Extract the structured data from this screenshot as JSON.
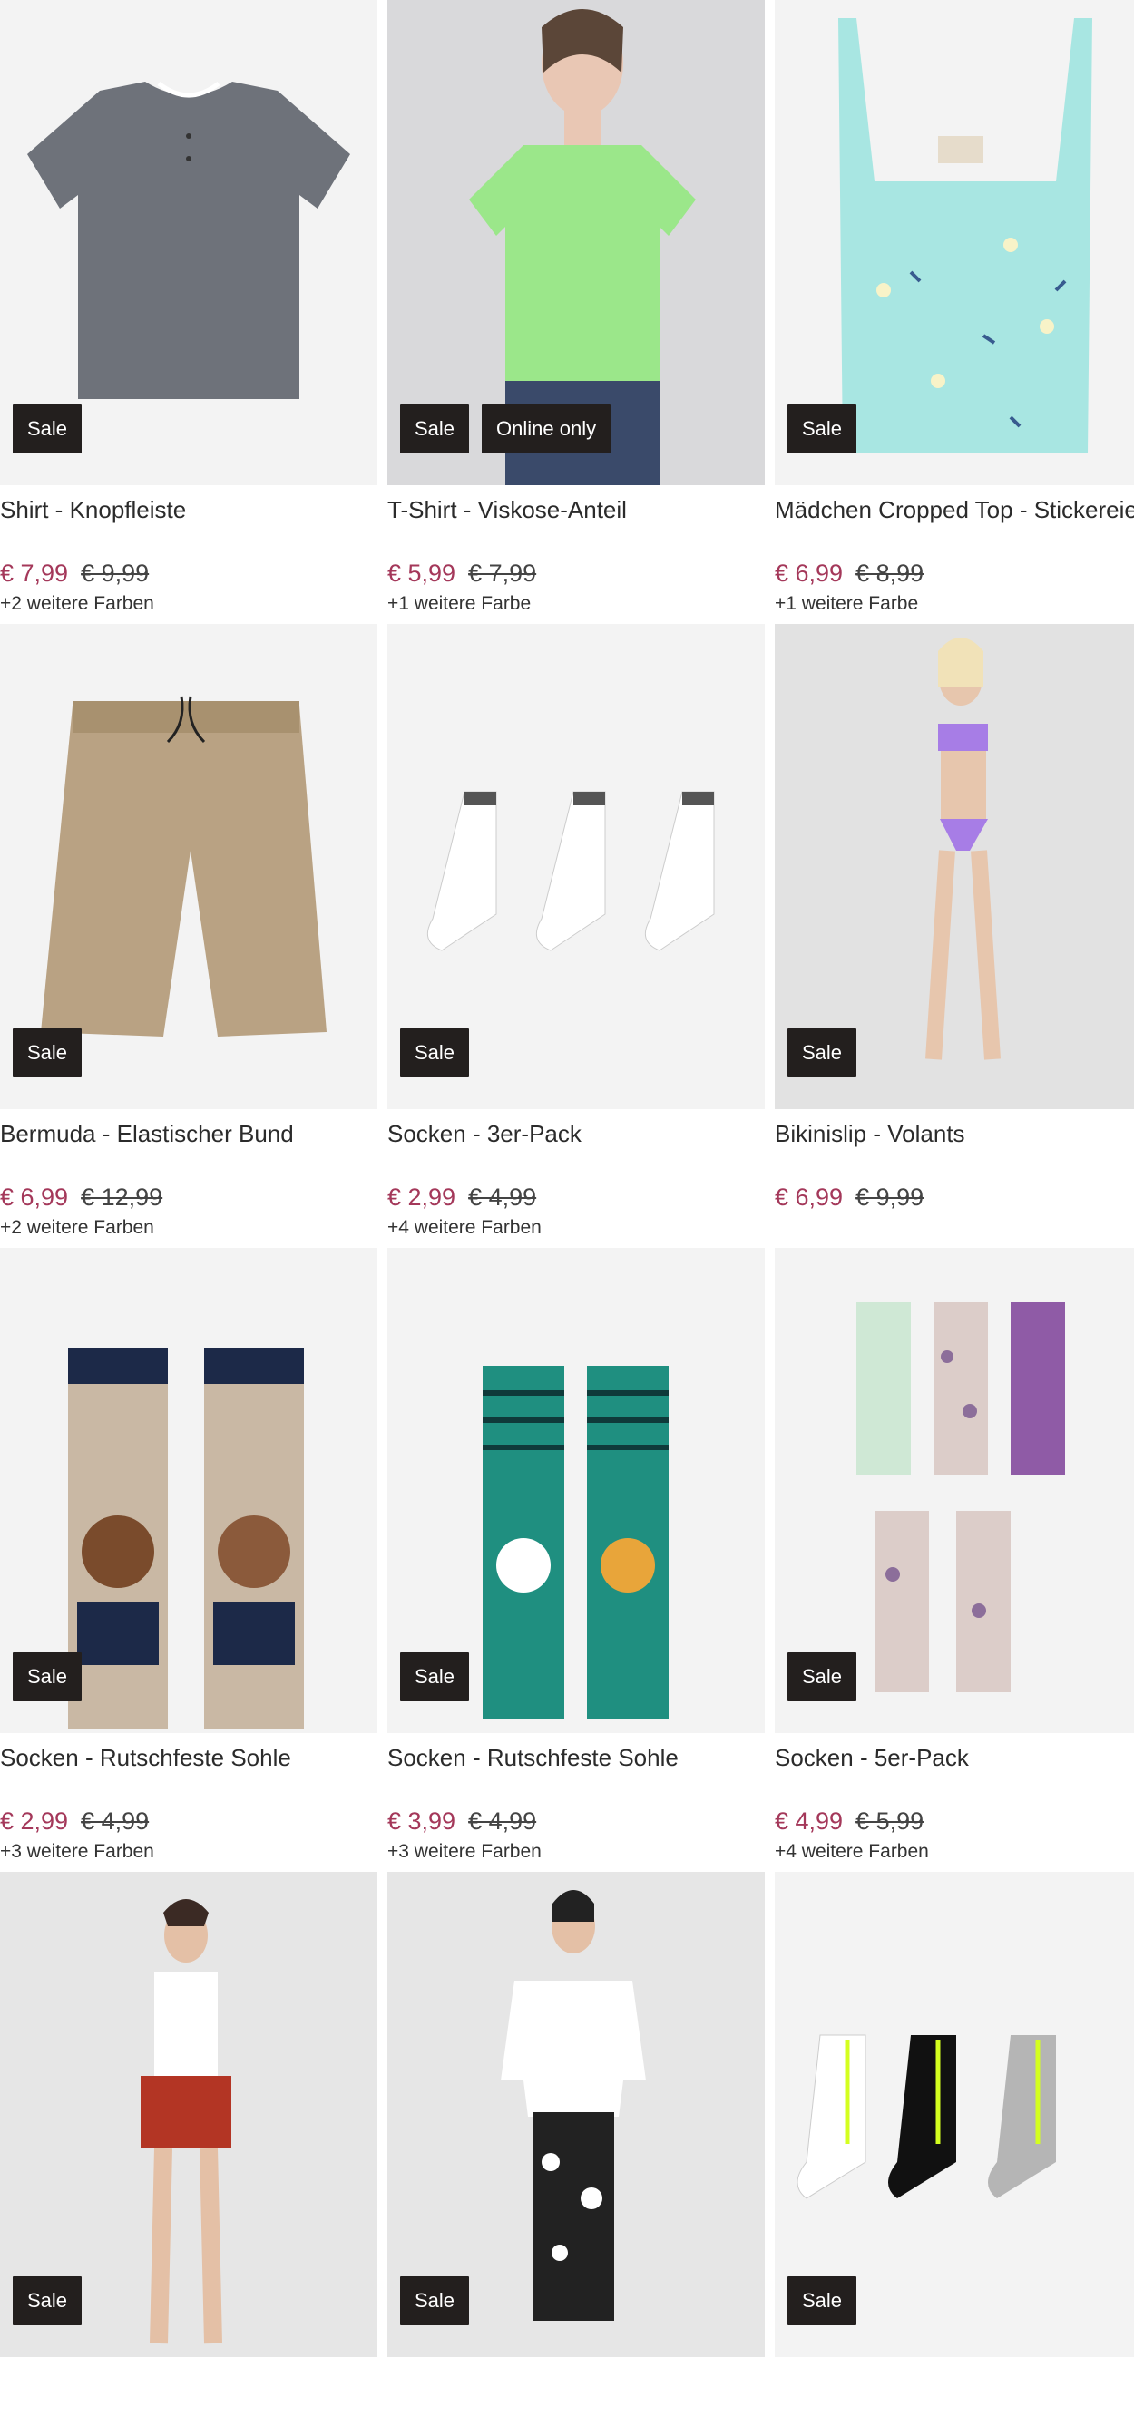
{
  "products": [
    {
      "title": "Shirt - Knopfleiste",
      "price": "€ 7,99",
      "old_price": "€ 9,99",
      "colors": "+2 weitere Farben",
      "badges": [
        "Sale"
      ],
      "image": "grey-henley-shirt"
    },
    {
      "title": "T-Shirt - Viskose-Anteil",
      "price": "€ 5,99",
      "old_price": "€ 7,99",
      "colors": "+1 weitere Farbe",
      "badges": [
        "Sale",
        "Online only"
      ],
      "image": "model-green-tshirt"
    },
    {
      "title": "Mädchen Cropped Top - Stickereien",
      "price": "€ 6,99",
      "old_price": "€ 8,99",
      "colors": "+1 weitere Farbe",
      "badges": [
        "Sale"
      ],
      "image": "mint-cropped-top"
    },
    {
      "title": "Bermuda - Elastischer Bund",
      "price": "€ 6,99",
      "old_price": "€ 12,99",
      "colors": "+2 weitere Farben",
      "badges": [
        "Sale"
      ],
      "image": "beige-bermuda-shorts"
    },
    {
      "title": "Socken - 3er-Pack",
      "price": "€ 2,99",
      "old_price": "€ 4,99",
      "colors": "+4 weitere Farben",
      "badges": [
        "Sale"
      ],
      "image": "white-grey-socks"
    },
    {
      "title": "Bikinislip - Volants",
      "price": "€ 6,99",
      "old_price": "€ 9,99",
      "colors": "",
      "badges": [
        "Sale"
      ],
      "image": "model-purple-bikini"
    },
    {
      "title": "Socken - Rutschfeste Sohle",
      "price": "€ 2,99",
      "old_price": "€ 4,99",
      "colors": "+3 weitere Farben",
      "badges": [
        "Sale"
      ],
      "image": "animal-socks-bear-monkey"
    },
    {
      "title": "Socken - Rutschfeste Sohle",
      "price": "€ 3,99",
      "old_price": "€ 4,99",
      "colors": "+3 weitere Farben",
      "badges": [
        "Sale"
      ],
      "image": "animal-socks-panda-tiger"
    },
    {
      "title": "Socken - 5er-Pack",
      "price": "€ 4,99",
      "old_price": "€ 5,99",
      "colors": "+4 weitere Farben",
      "badges": [
        "Sale"
      ],
      "image": "dotted-socks-5pack"
    },
    {
      "title": "",
      "price": "",
      "old_price": "",
      "colors": "",
      "badges": [
        "Sale"
      ],
      "image": "model-red-shorts"
    },
    {
      "title": "",
      "price": "",
      "old_price": "",
      "colors": "",
      "badges": [
        "Sale"
      ],
      "image": "model-white-tee-leggings"
    },
    {
      "title": "",
      "price": "",
      "old_price": "",
      "colors": "",
      "badges": [
        "Sale"
      ],
      "image": "sport-socks-3pack"
    }
  ]
}
